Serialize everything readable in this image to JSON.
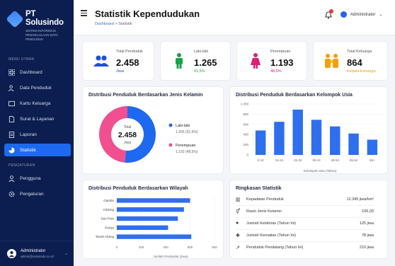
{
  "brand": {
    "name": "PT Solusindo",
    "subtitle": [
      "Sistem Informasi",
      "Pengelolaan Data Penduduk"
    ]
  },
  "sidebar": {
    "section_main": "Menu Utama",
    "section_settings": "Pengaturan",
    "items": [
      {
        "label": "Dashboard",
        "icon": "grid-icon"
      },
      {
        "label": "Data Penduduk",
        "icon": "users-icon"
      },
      {
        "label": "Kartu Keluarga",
        "icon": "card-icon"
      },
      {
        "label": "Surat & Layanan",
        "icon": "document-icon"
      },
      {
        "label": "Laporan",
        "icon": "report-icon"
      },
      {
        "label": "Statistik",
        "icon": "pie-chart-icon",
        "active": true
      }
    ],
    "settings_items": [
      {
        "label": "Pengguna",
        "icon": "user-icon"
      },
      {
        "label": "Pengaturan",
        "icon": "gear-icon"
      }
    ],
    "user": {
      "name": "Administrator",
      "email": "admin@solusindo.co.id"
    }
  },
  "header": {
    "title": "Statistik Kependudukan",
    "breadcrumb": [
      "Dashboard",
      ">",
      "Statistik"
    ],
    "user_label": "Administrator"
  },
  "stats": [
    {
      "label": "Total Penduduk",
      "value": "2.458",
      "sub": "Jiwa",
      "color": "#1d4ed8",
      "icon": "people-icon"
    },
    {
      "label": "Laki-laki",
      "value": "1.265",
      "sub": "51,5%",
      "color": "#16a34a",
      "icon": "male-icon"
    },
    {
      "label": "Perempuan",
      "value": "1.193",
      "sub": "48,5%",
      "color": "#e11d74",
      "icon": "female-icon"
    },
    {
      "label": "Total Keluarga",
      "value": "864",
      "sub": "Kepala Keluarga",
      "color": "#f59e0b",
      "icon": "family-icon"
    }
  ],
  "gender_chart": {
    "title": "Distribusi Penduduk Berdasarkan Jenis Kelamin",
    "center_label": "Total",
    "center_value": "2.458",
    "center_unit": "Jiwa",
    "legend": [
      {
        "name": "Laki-laki",
        "detail": "1.265 (51,5%)",
        "color": "#1d6af0"
      },
      {
        "name": "Perempuan",
        "detail": "1.193 (48,5%)",
        "color": "#f0508f"
      }
    ]
  },
  "age_chart": {
    "title": "Distribusi Penduduk Berdasarkan Kelompok Usia",
    "xlabel": "Kelompok Usia (Tahun)"
  },
  "region_chart": {
    "title": "Distribusi Penduduk Berdasarkan Wilayah",
    "xlabel": "Jumlah Penduduk (Jiwa)"
  },
  "summary": {
    "title": "Ringkasan Statistik",
    "rows": [
      {
        "icon": "building-icon",
        "label": "Kepadatan Penduduk",
        "value": "12.345 jiwa/km²"
      },
      {
        "icon": "ratio-icon",
        "label": "Rasio Jenis Kelamin",
        "value": "106,03"
      },
      {
        "icon": "baby-icon",
        "label": "Jumlah Kelahiran (Tahun Ini)",
        "value": "125 jiwa"
      },
      {
        "icon": "cross-icon",
        "label": "Jumlah Kematian (Tahun Ini)",
        "value": "78 jiwa"
      },
      {
        "icon": "trend-icon",
        "label": "Penduduk Pendatang (Tahun Ini)",
        "value": "210 jiwa"
      }
    ]
  },
  "chart_data": [
    {
      "type": "pie",
      "title": "Distribusi Penduduk Berdasarkan Jenis Kelamin",
      "categories": [
        "Laki-laki",
        "Perempuan"
      ],
      "values": [
        1265,
        1193
      ]
    },
    {
      "type": "bar",
      "title": "Distribusi Penduduk Berdasarkan Kelompok Usia",
      "categories": [
        "0-14",
        "15-24",
        "25-34",
        "35-44",
        "45-54",
        "55-64",
        "65+"
      ],
      "values": [
        480,
        650,
        890,
        690,
        560,
        420,
        300
      ],
      "xlabel": "Kelompok Usia (Tahun)",
      "ylabel": "",
      "ylim": [
        0,
        1000
      ],
      "yticks": [
        0,
        200,
        400,
        600,
        800,
        1000
      ]
    },
    {
      "type": "bar",
      "orientation": "horizontal",
      "title": "Distribusi Penduduk Berdasarkan Wilayah",
      "categories": [
        "Gambir",
        "Cibiring",
        "Duri Pulo",
        "Petojo",
        "Tanah Abang"
      ],
      "values": [
        600,
        550,
        500,
        420,
        610
      ],
      "xlabel": "Jumlah Penduduk (Jiwa)",
      "xlim": [
        0,
        800
      ],
      "xticks": [
        0,
        200,
        400,
        600,
        800
      ]
    }
  ]
}
